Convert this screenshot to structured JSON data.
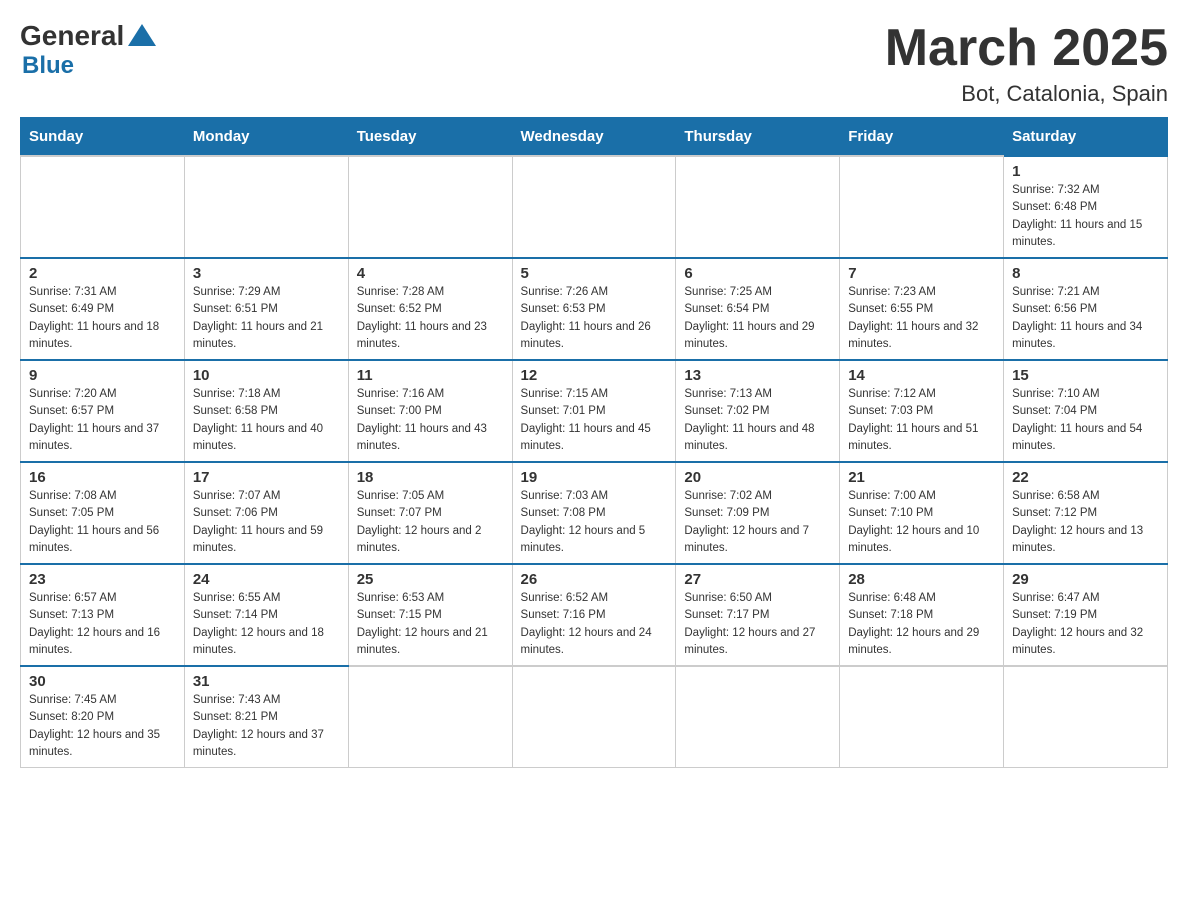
{
  "header": {
    "logo_general": "General",
    "logo_blue": "Blue",
    "title": "March 2025",
    "subtitle": "Bot, Catalonia, Spain"
  },
  "weekdays": [
    "Sunday",
    "Monday",
    "Tuesday",
    "Wednesday",
    "Thursday",
    "Friday",
    "Saturday"
  ],
  "weeks": [
    [
      {
        "day": "",
        "info": ""
      },
      {
        "day": "",
        "info": ""
      },
      {
        "day": "",
        "info": ""
      },
      {
        "day": "",
        "info": ""
      },
      {
        "day": "",
        "info": ""
      },
      {
        "day": "",
        "info": ""
      },
      {
        "day": "1",
        "info": "Sunrise: 7:32 AM\nSunset: 6:48 PM\nDaylight: 11 hours and 15 minutes."
      }
    ],
    [
      {
        "day": "2",
        "info": "Sunrise: 7:31 AM\nSunset: 6:49 PM\nDaylight: 11 hours and 18 minutes."
      },
      {
        "day": "3",
        "info": "Sunrise: 7:29 AM\nSunset: 6:51 PM\nDaylight: 11 hours and 21 minutes."
      },
      {
        "day": "4",
        "info": "Sunrise: 7:28 AM\nSunset: 6:52 PM\nDaylight: 11 hours and 23 minutes."
      },
      {
        "day": "5",
        "info": "Sunrise: 7:26 AM\nSunset: 6:53 PM\nDaylight: 11 hours and 26 minutes."
      },
      {
        "day": "6",
        "info": "Sunrise: 7:25 AM\nSunset: 6:54 PM\nDaylight: 11 hours and 29 minutes."
      },
      {
        "day": "7",
        "info": "Sunrise: 7:23 AM\nSunset: 6:55 PM\nDaylight: 11 hours and 32 minutes."
      },
      {
        "day": "8",
        "info": "Sunrise: 7:21 AM\nSunset: 6:56 PM\nDaylight: 11 hours and 34 minutes."
      }
    ],
    [
      {
        "day": "9",
        "info": "Sunrise: 7:20 AM\nSunset: 6:57 PM\nDaylight: 11 hours and 37 minutes."
      },
      {
        "day": "10",
        "info": "Sunrise: 7:18 AM\nSunset: 6:58 PM\nDaylight: 11 hours and 40 minutes."
      },
      {
        "day": "11",
        "info": "Sunrise: 7:16 AM\nSunset: 7:00 PM\nDaylight: 11 hours and 43 minutes."
      },
      {
        "day": "12",
        "info": "Sunrise: 7:15 AM\nSunset: 7:01 PM\nDaylight: 11 hours and 45 minutes."
      },
      {
        "day": "13",
        "info": "Sunrise: 7:13 AM\nSunset: 7:02 PM\nDaylight: 11 hours and 48 minutes."
      },
      {
        "day": "14",
        "info": "Sunrise: 7:12 AM\nSunset: 7:03 PM\nDaylight: 11 hours and 51 minutes."
      },
      {
        "day": "15",
        "info": "Sunrise: 7:10 AM\nSunset: 7:04 PM\nDaylight: 11 hours and 54 minutes."
      }
    ],
    [
      {
        "day": "16",
        "info": "Sunrise: 7:08 AM\nSunset: 7:05 PM\nDaylight: 11 hours and 56 minutes."
      },
      {
        "day": "17",
        "info": "Sunrise: 7:07 AM\nSunset: 7:06 PM\nDaylight: 11 hours and 59 minutes."
      },
      {
        "day": "18",
        "info": "Sunrise: 7:05 AM\nSunset: 7:07 PM\nDaylight: 12 hours and 2 minutes."
      },
      {
        "day": "19",
        "info": "Sunrise: 7:03 AM\nSunset: 7:08 PM\nDaylight: 12 hours and 5 minutes."
      },
      {
        "day": "20",
        "info": "Sunrise: 7:02 AM\nSunset: 7:09 PM\nDaylight: 12 hours and 7 minutes."
      },
      {
        "day": "21",
        "info": "Sunrise: 7:00 AM\nSunset: 7:10 PM\nDaylight: 12 hours and 10 minutes."
      },
      {
        "day": "22",
        "info": "Sunrise: 6:58 AM\nSunset: 7:12 PM\nDaylight: 12 hours and 13 minutes."
      }
    ],
    [
      {
        "day": "23",
        "info": "Sunrise: 6:57 AM\nSunset: 7:13 PM\nDaylight: 12 hours and 16 minutes."
      },
      {
        "day": "24",
        "info": "Sunrise: 6:55 AM\nSunset: 7:14 PM\nDaylight: 12 hours and 18 minutes."
      },
      {
        "day": "25",
        "info": "Sunrise: 6:53 AM\nSunset: 7:15 PM\nDaylight: 12 hours and 21 minutes."
      },
      {
        "day": "26",
        "info": "Sunrise: 6:52 AM\nSunset: 7:16 PM\nDaylight: 12 hours and 24 minutes."
      },
      {
        "day": "27",
        "info": "Sunrise: 6:50 AM\nSunset: 7:17 PM\nDaylight: 12 hours and 27 minutes."
      },
      {
        "day": "28",
        "info": "Sunrise: 6:48 AM\nSunset: 7:18 PM\nDaylight: 12 hours and 29 minutes."
      },
      {
        "day": "29",
        "info": "Sunrise: 6:47 AM\nSunset: 7:19 PM\nDaylight: 12 hours and 32 minutes."
      }
    ],
    [
      {
        "day": "30",
        "info": "Sunrise: 7:45 AM\nSunset: 8:20 PM\nDaylight: 12 hours and 35 minutes."
      },
      {
        "day": "31",
        "info": "Sunrise: 7:43 AM\nSunset: 8:21 PM\nDaylight: 12 hours and 37 minutes."
      },
      {
        "day": "",
        "info": ""
      },
      {
        "day": "",
        "info": ""
      },
      {
        "day": "",
        "info": ""
      },
      {
        "day": "",
        "info": ""
      },
      {
        "day": "",
        "info": ""
      }
    ]
  ]
}
